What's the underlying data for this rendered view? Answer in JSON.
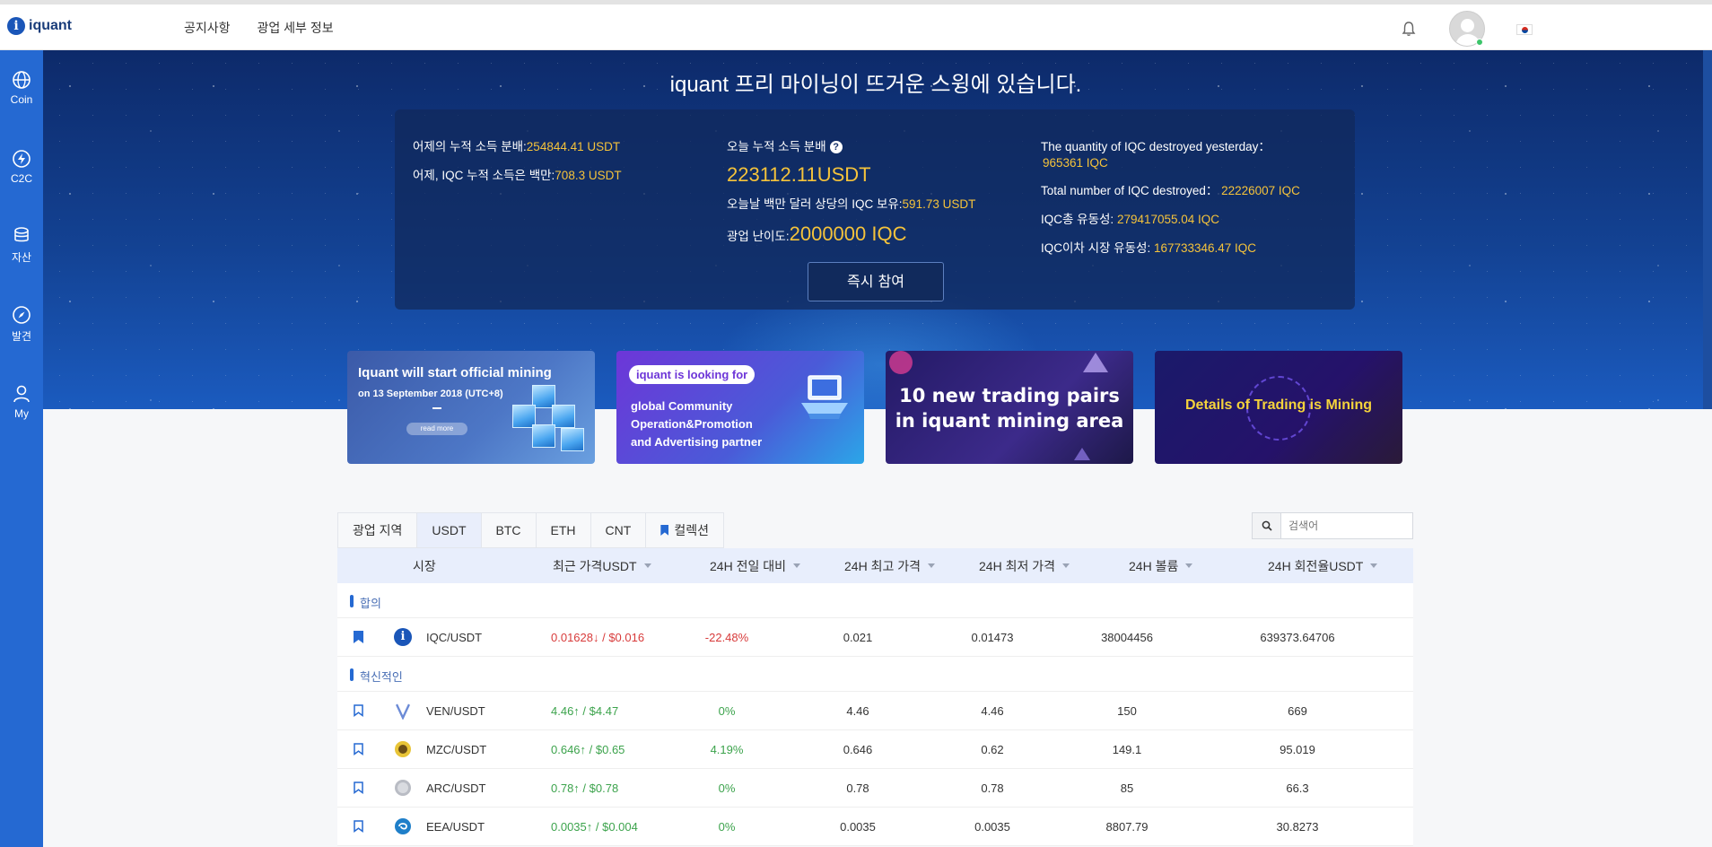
{
  "header": {
    "logo_text": "iquant",
    "nav": [
      "공지사항",
      "광업 세부 정보"
    ]
  },
  "sidebar": {
    "items": [
      {
        "label": "Coin",
        "icon": "globe-icon"
      },
      {
        "label": "C2C",
        "icon": "bolt-icon"
      },
      {
        "label": "자산",
        "icon": "coins-icon"
      },
      {
        "label": "발견",
        "icon": "compass-icon"
      },
      {
        "label": "My",
        "icon": "user-icon"
      }
    ]
  },
  "hero": {
    "title": "iquant 프리 마이닝이 뜨거운 스윙에 있습니다.",
    "col1": {
      "yesterday_cum_label": "어제의 누적 소득 분배:",
      "yesterday_cum_value": "254844.41 USDT",
      "yesterday_iqc_label": "어제, IQC 누적 소득은 백만:",
      "yesterday_iqc_value": "708.3 USDT"
    },
    "col2": {
      "today_cum_label": "오늘 누적 소득 분배",
      "help_glyph": "?",
      "today_cum_value": "223112.11USDT",
      "today_hold_label": "오늘날 백만 달러 상당의 IQC 보유:",
      "today_hold_value": "591.73 USDT",
      "difficulty_label": "광업 난이도:",
      "difficulty_value": "2000000 IQC"
    },
    "col3": {
      "destroyed_yesterday_label": "The quantity of IQC destroyed yesterday：",
      "destroyed_yesterday_value": "965361 IQC",
      "destroyed_total_label": "Total number of IQC destroyed：",
      "destroyed_total_value": "22226007 IQC",
      "total_liquidity_label": "IQC총 유동성:",
      "total_liquidity_value": "279417055.04 IQC",
      "secondary_liquidity_label": "IQC이차 시장 유동성:",
      "secondary_liquidity_value": "167733346.47 IQC"
    },
    "join_button": "즉시 참여"
  },
  "banners": {
    "b1_line1": "Iquant will start official mining",
    "b1_line2": "on 13 September 2018 (UTC+8)",
    "b1_more": "read more",
    "b2_pill": "iquant is looking for",
    "b2_line1": "global Community",
    "b2_line2": "Operation&Promotion",
    "b2_line3": "and Advertising partner",
    "b3_line1": "10 new trading pairs",
    "b3_line2": "in iquant mining area",
    "b4_text": "Details of Trading is Mining"
  },
  "market": {
    "tabs": [
      "광업 지역",
      "USDT",
      "BTC",
      "ETH",
      "CNT",
      "컬렉션"
    ],
    "active_tab": "USDT",
    "search_placeholder": "검색어",
    "columns": [
      "시장",
      "최근 가격USDT",
      "24H 전일 대비",
      "24H 최고 가격",
      "24H 최저 가격",
      "24H 볼륨",
      "24H 회전율USDT"
    ],
    "groups": [
      {
        "label": "합의",
        "rows": [
          {
            "pair": "IQC/USDT",
            "price": "0.01628↓ / $0.016",
            "change": "-22.48%",
            "high": "0.021",
            "low": "0.01473",
            "volume": "38004456",
            "turnover": "639373.64706",
            "trend": "down"
          }
        ]
      },
      {
        "label": "혁신적인",
        "rows": [
          {
            "pair": "VEN/USDT",
            "price": "4.46↑ / $4.47",
            "change": "0%",
            "high": "4.46",
            "low": "4.46",
            "volume": "150",
            "turnover": "669",
            "trend": "up"
          },
          {
            "pair": "MZC/USDT",
            "price": "0.646↑ / $0.65",
            "change": "4.19%",
            "high": "0.646",
            "low": "0.62",
            "volume": "149.1",
            "turnover": "95.019",
            "trend": "up"
          },
          {
            "pair": "ARC/USDT",
            "price": "0.78↑ / $0.78",
            "change": "0%",
            "high": "0.78",
            "low": "0.78",
            "volume": "85",
            "turnover": "66.3",
            "trend": "up"
          },
          {
            "pair": "EEA/USDT",
            "price": "0.0035↑ / $0.004",
            "change": "0%",
            "high": "0.0035",
            "low": "0.0035",
            "volume": "8807.79",
            "turnover": "30.8273",
            "trend": "up"
          }
        ]
      }
    ]
  },
  "colors": {
    "accent": "#2569d2",
    "hero_dark": "#0d2a6a",
    "highlight_yellow": "#f5c33b",
    "down_red": "#d83b3b",
    "up_green": "#3ca34c"
  }
}
